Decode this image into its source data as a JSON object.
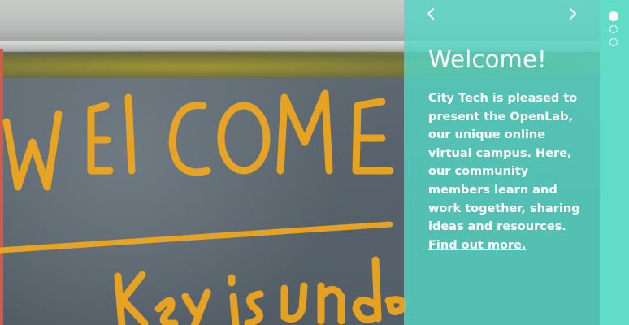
{
  "slide": {
    "title": "Welcome!",
    "body": "City Tech is pleased to present the OpenLab, our unique online virtual campus. Here, our community members learn and work together, sharing ideas and resources.",
    "link_label": "Find out more.",
    "image_alt": "Chalk graffiti on pavement"
  },
  "navigation": {
    "prev_icon": "chevron-left-icon",
    "next_icon": "chevron-right-icon"
  },
  "pager": {
    "count": 3,
    "active_index": 0
  },
  "colors": {
    "panel_teal": "#54d6c4",
    "rail_teal": "#61dcc6",
    "text": "#ffffff",
    "chalk": "#f2a81d"
  }
}
